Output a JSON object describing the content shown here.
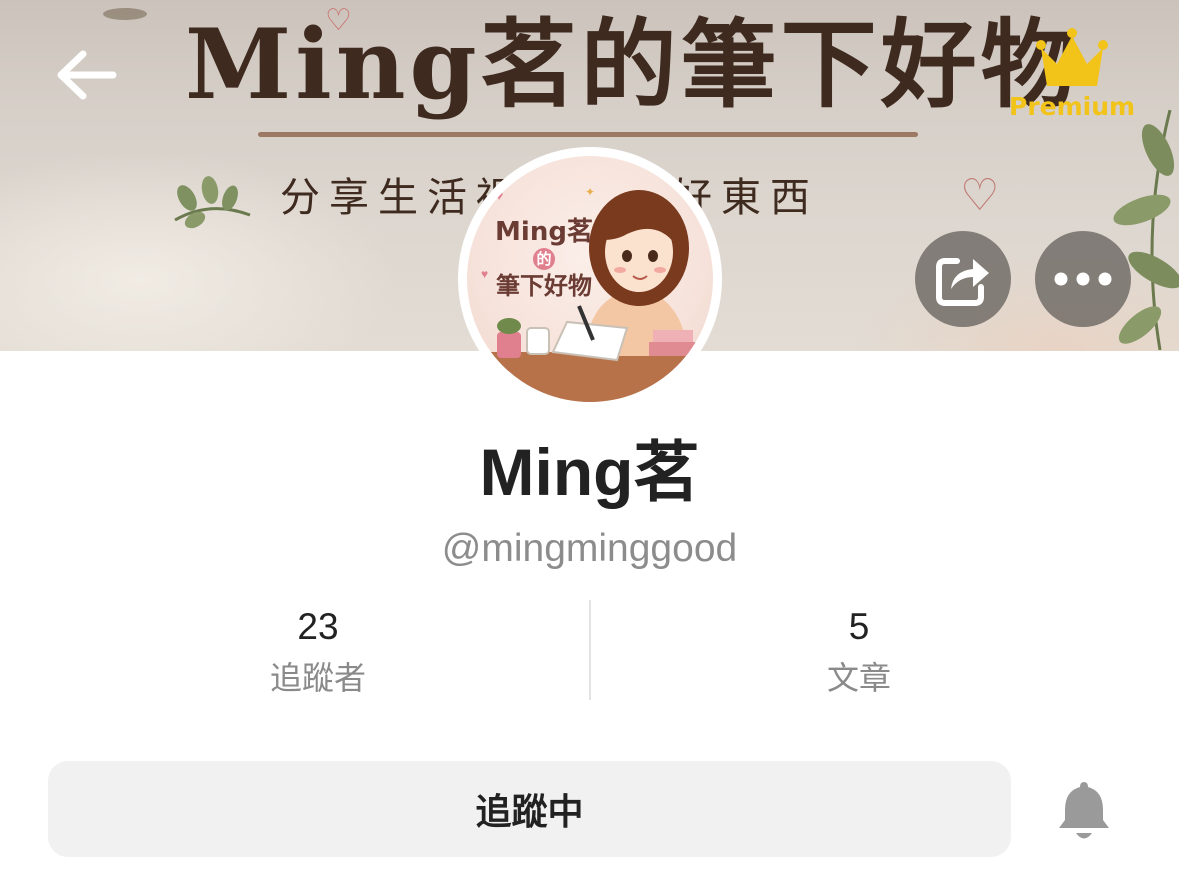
{
  "header": {
    "banner_title": "Ming茗的筆下好物",
    "banner_subtitle": "分享生活裡收藏的好東西",
    "premium_label": "Premium"
  },
  "avatar": {
    "line1": "Ming茗",
    "line2": "的",
    "line3": "筆下好物"
  },
  "profile": {
    "display_name": "Ming茗",
    "handle": "@mingminggood"
  },
  "stats": {
    "followers_value": "23",
    "followers_label": "追蹤者",
    "articles_value": "5",
    "articles_label": "文章"
  },
  "actions": {
    "follow_label": "追蹤中"
  },
  "icons": {
    "back": "arrow-left-icon",
    "premium": "crown-icon",
    "share": "share-icon",
    "more": "more-horizontal-icon",
    "bell": "bell-icon"
  },
  "colors": {
    "premium_gold": "#f2c318",
    "button_bg": "#f1f1f1",
    "text_primary": "#222222",
    "text_secondary": "#8a8a8a"
  }
}
